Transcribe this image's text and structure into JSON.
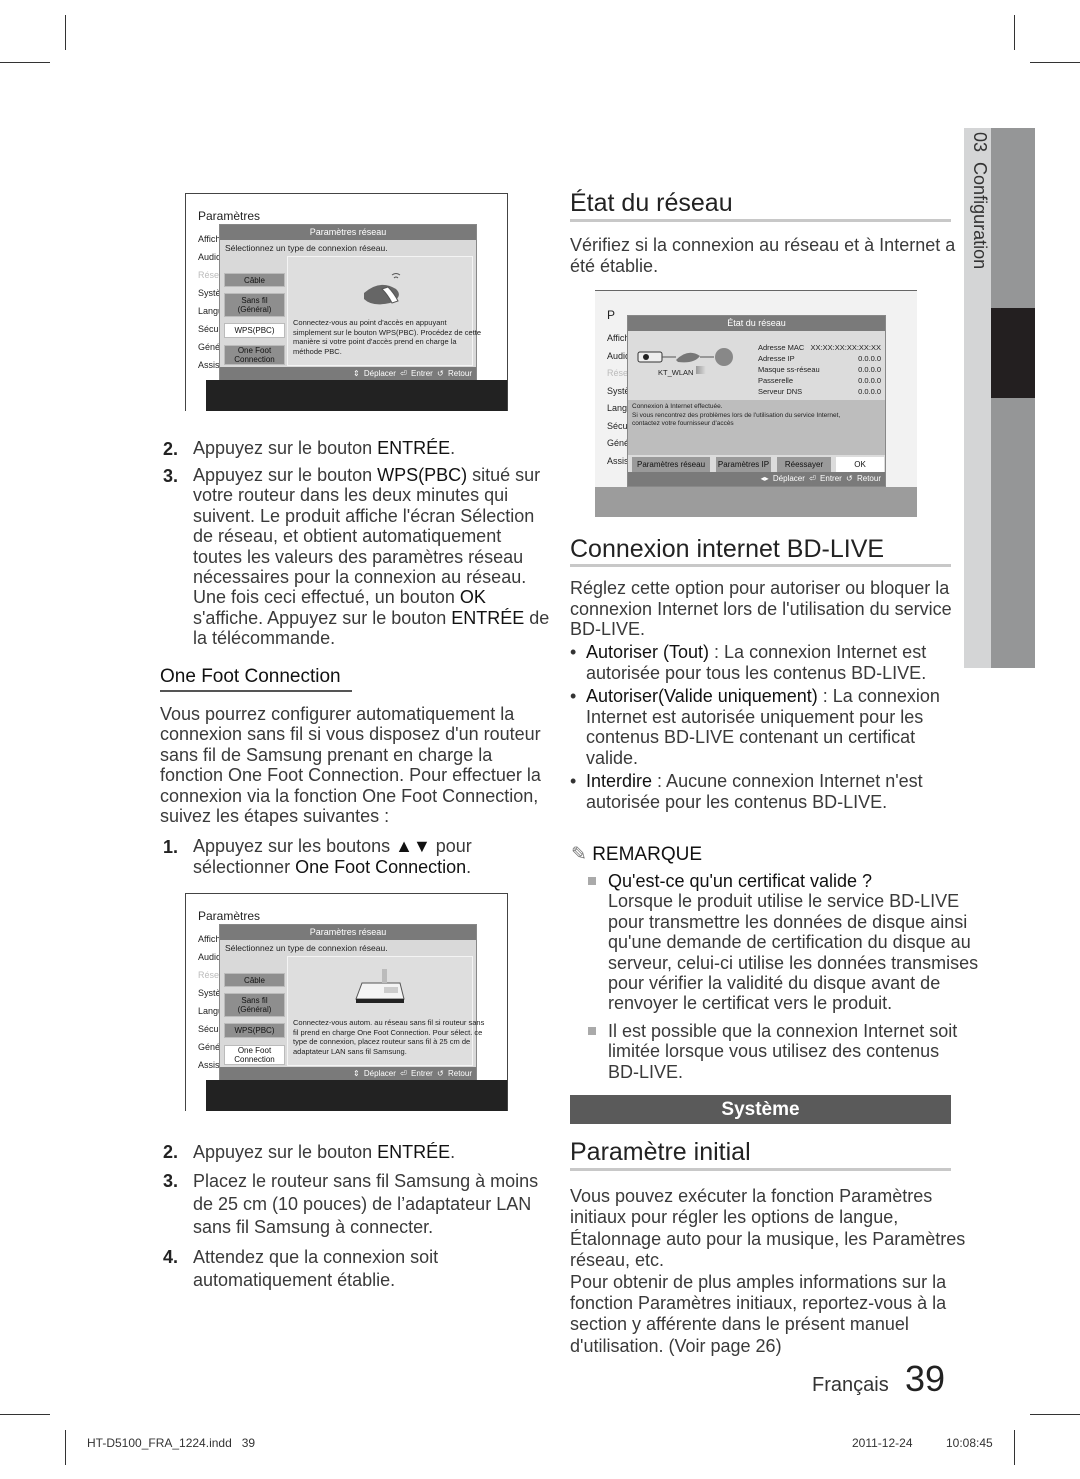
{
  "side_tab": {
    "number": "03",
    "label": "Configuration"
  },
  "left": {
    "shot1": {
      "title": "Paramètres",
      "menu": [
        "Affich",
        "Audio",
        "Réseau",
        "Système",
        "Langue",
        "Sécurité",
        "Général",
        "Assistance"
      ],
      "dialog_title": "Paramètres réseau",
      "prompt": "Sélectionnez un type de connexion réseau.",
      "options": [
        "Câble",
        "Sans fil (Général)",
        "WPS(PBC)",
        "One Foot Connection"
      ],
      "selected": "WPS(PBC)",
      "icon": "router-wps-button-icon",
      "description": [
        "Connectez-vous au point d'accès en appuyant",
        "simplement sur le bouton WPS(PBC). Procédez de cette",
        "manière si votre point d'accès prend en charge la",
        "méthode PBC."
      ],
      "footer": "⇕ Déplacer   ⏎ Entrer   ↺ Retour"
    },
    "steps_a": [
      {
        "n": "2.",
        "lines": [
          "Appuyez sur le bouton **ENTRÉE**."
        ]
      },
      {
        "n": "3.",
        "lines": [
          "Appuyez sur le bouton **WPS(PBC)** situé sur",
          "votre routeur dans les deux minutes qui",
          "suivent. Le produit affiche l'écran Sélection",
          "de réseau, et obtient automatiquement",
          "toutes les valeurs des paramètres réseau",
          "nécessaires pour la connexion au réseau.",
          "Une fois ceci effectué, un bouton **OK**",
          "s'affiche. Appuyez sur le bouton **ENTRÉE** de",
          "la télécommande."
        ]
      }
    ],
    "ofc_heading": "One Foot Connection",
    "ofc_para": [
      "Vous pourrez configurer automatiquement la",
      "connexion sans fil si vous disposez d'un routeur",
      "sans fil de Samsung prenant en charge la",
      "fonction One Foot Connection. Pour effectuer la",
      "connexion via la fonction One Foot Connection,",
      "suivez les étapes suivantes :"
    ],
    "steps_b": [
      {
        "n": "1.",
        "lines": [
          "Appuyez sur les boutons **▲▼** pour",
          "sélectionner **One Foot Connection**."
        ]
      }
    ],
    "shot2": {
      "title": "Paramètres",
      "menu": [
        "Affich",
        "Audio",
        "Réseau",
        "Système",
        "Langue",
        "Sécurité",
        "Général",
        "Assistance"
      ],
      "dialog_title": "Paramètres réseau",
      "prompt": "Sélectionnez un type de connexion réseau.",
      "options": [
        "Câble",
        "Sans fil (Général)",
        "WPS(PBC)",
        "One Foot Connection"
      ],
      "selected": "One Foot Connection",
      "icon": "wireless-lan-adapter-icon",
      "description": [
        "Connectez-vous autom. au réseau sans fil si routeur sans",
        "fil prend en charge One Foot Connection. Pour sélect. ce",
        "type de connexion, placez routeur sans fil à 25 cm de",
        "adaptateur LAN sans fil Samsung."
      ],
      "footer": "⇕ Déplacer   ⏎ Entrer   ↺ Retour"
    },
    "steps_c": [
      {
        "n": "2.",
        "lines": [
          "Appuyez sur le bouton **ENTRÉE**."
        ]
      },
      {
        "n": "3.",
        "lines": [
          "Placez le routeur sans fil Samsung à moins",
          "de 25 cm (10 pouces) de l’adaptateur LAN",
          "sans fil Samsung à connecter."
        ]
      },
      {
        "n": "4.",
        "lines": [
          "Attendez que la connexion soit",
          "automatiquement établie."
        ]
      }
    ]
  },
  "right": {
    "etat_heading": "État du réseau",
    "etat_para": [
      "Vérifiez si la connexion au réseau et à Internet a",
      "été établie."
    ],
    "shot3": {
      "title": "P",
      "menu": [
        "Affich",
        "Audio",
        "Réseau",
        "Système",
        "Langue",
        "Sécurité",
        "Général",
        "Assistance"
      ],
      "dialog_title": "État du réseau",
      "network_name": "KT_WLAN",
      "info": [
        {
          "label": "Adresse MAC",
          "value": "XX:XX:XX:XX:XX:XX"
        },
        {
          "label": "Adresse IP",
          "value": "0.0.0.0"
        },
        {
          "label": "Masque ss-réseau",
          "value": "0.0.0.0"
        },
        {
          "label": "Passerelle",
          "value": "0.0.0.0"
        },
        {
          "label": "Serveur DNS",
          "value": "0.0.0.0"
        }
      ],
      "message": [
        "Connexion à Internet effectuée.",
        "Si vous rencontrez des problèmes lors de l'utilisation du service Internet,",
        "contactez votre fournisseur d'accès"
      ],
      "buttons": [
        "Paramètres réseau",
        "Paramètres IP",
        "Réessayer",
        "OK"
      ],
      "selected": "OK",
      "footer": "◂▸ Déplacer   ⏎ Entrer   ↺ Retour"
    },
    "bd_heading": "Connexion internet BD-LIVE",
    "bd_para": [
      "Réglez cette option pour autoriser ou bloquer la",
      "connexion Internet lors de l'utilisation du service",
      "BD-LIVE."
    ],
    "bd_bullets": [
      [
        "**Autoriser (Tout)** : La connexion Internet est",
        "autorisée pour tous les contenus BD-LIVE."
      ],
      [
        "**Autoriser(Valide uniquement)** : La connexion",
        "Internet est autorisée uniquement pour les",
        "contenus BD-LIVE contenant un certificat",
        "valide."
      ],
      [
        "**Interdire** : Aucune connexion Internet n'est",
        "autorisée pour les contenus BD-LIVE."
      ]
    ],
    "note_label": "REMARQUE",
    "notes": [
      [
        "**Qu'est-ce qu'un certificat valide ?**",
        "Lorsque le produit utilise le service BD-LIVE",
        "pour transmettre les données de disque ainsi",
        "qu'une demande de certification du disque au",
        "serveur, celui-ci utilise les données transmises",
        "pour vérifier la validité du disque avant de",
        "renvoyer le certificat vers le produit."
      ],
      [
        "Il est possible que la connexion Internet soit",
        "limitée lorsque vous utilisez des contenus",
        "BD-LIVE."
      ]
    ],
    "section_bar": "Système",
    "init_heading": "Paramètre initial",
    "init_para": [
      "Vous pouvez exécuter la fonction Paramètres",
      "initiaux pour régler les options de langue,",
      "Étalonnage auto pour la musique, les Paramètres",
      "réseau, etc.",
      "Pour obtenir de plus amples informations sur la",
      "fonction Paramètres initiaux, reportez-vous à la",
      "section y afférente dans le présent manuel",
      "d'utilisation. (Voir page 26)"
    ]
  },
  "page": {
    "language": "Français",
    "number": "39"
  },
  "footer": {
    "file": "HT-D5100_FRA_1224.indd   39",
    "date": "2011-12-24",
    "time": "10:08:45"
  },
  "colors": {
    "section_bar": "#5a5a5a",
    "side_tab_light": "#d4d5d6",
    "side_tab_dark": "#959697",
    "side_tab_active": "#231f20"
  }
}
